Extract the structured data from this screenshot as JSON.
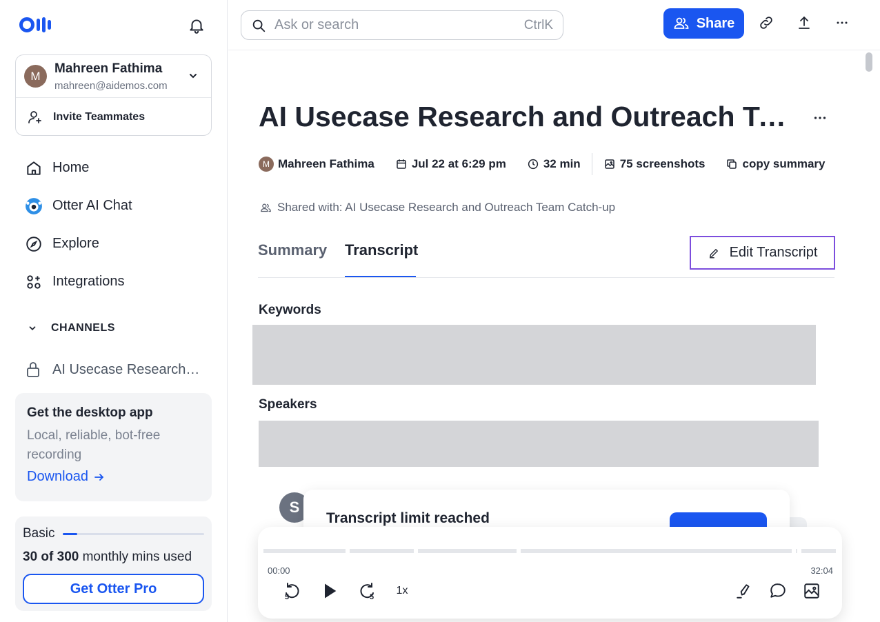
{
  "sidebar": {
    "account": {
      "avatar_letter": "M",
      "name": "Mahreen Fathima",
      "email": "mahreen@aidemos.com"
    },
    "invite_label": "Invite Teammates",
    "nav": [
      {
        "label": "Home"
      },
      {
        "label": "Otter AI Chat"
      },
      {
        "label": "Explore"
      },
      {
        "label": "Integrations"
      }
    ],
    "channels_label": "CHANNELS",
    "channel_item": "AI Usecase Research and Outreach Team Catch-up",
    "desktop_card": {
      "title": "Get the desktop app",
      "description": "Local, reliable, bot-free recording",
      "link": "Download"
    },
    "plan": {
      "name": "Basic",
      "used": "30 of 300",
      "suffix": "monthly mins used",
      "used_fraction": 0.1,
      "cta": "Get Otter Pro"
    }
  },
  "topbar": {
    "search_placeholder": "Ask or search",
    "search_shortcut": "CtrlK",
    "share_label": "Share"
  },
  "conversation": {
    "title": "AI Usecase Research and Outreach Team Catch-up",
    "owner": "Mahreen Fathima",
    "owner_initial": "M",
    "date": "Jul 22 at 6:29 pm",
    "duration": "32 min",
    "screenshots": "75 screenshots",
    "copy_summary": "copy summary",
    "shared_with": "Shared with: AI Usecase Research and Outreach Team Catch-up"
  },
  "tabs": {
    "summary": "Summary",
    "transcript": "Transcript",
    "edit": "Edit Transcript"
  },
  "sections": {
    "keywords": "Keywords",
    "speakers": "Speakers"
  },
  "limit": {
    "speaker_initial": "S",
    "title": "Transcript limit reached"
  },
  "player": {
    "current": "00:00",
    "total": "32:04",
    "rewind": "5",
    "forward": "5",
    "speed": "1x"
  },
  "colors": {
    "accent": "#1a56f0",
    "edit_border": "#7c4ddd",
    "placeholder": "#d4d5d8"
  }
}
